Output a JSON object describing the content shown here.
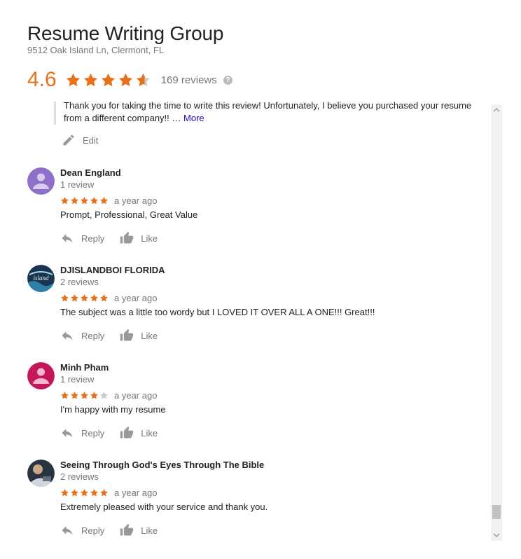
{
  "business": {
    "title": "Resume Writing Group",
    "address": "9512 Oak Island Ln, Clermont, FL",
    "rating": "4.6",
    "rating_value": 4.6,
    "review_count": "169 reviews",
    "help_glyph": "?"
  },
  "owner_reply": {
    "text": "Thank you for taking the time to write this review! Unfortunately, I believe you purchased your resume from a different company!!",
    "ellipsis": " … ",
    "more_label": "More",
    "edit_label": "Edit"
  },
  "reviews": [
    {
      "name": "Dean England",
      "sub": "1 review",
      "stars": 5,
      "time": "a year ago",
      "text": "Prompt, Professional, Great Value",
      "reply_label": "Reply",
      "like_label": "Like",
      "avatar_color": "#8e6fc9"
    },
    {
      "name": "DJISLANDBOI FLORIDA",
      "sub": "2 reviews",
      "stars": 5,
      "time": "a year ago",
      "text": "The subject was a little too wordy but I LOVED IT OVER ALL A ONE!!! Great!!!",
      "reply_label": "Reply",
      "like_label": "Like",
      "avatar_color": "#1b3550"
    },
    {
      "name": "Minh Pham",
      "sub": "1 review",
      "stars": 4,
      "time": "a year ago",
      "text": "I'm happy with my resume",
      "reply_label": "Reply",
      "like_label": "Like",
      "avatar_color": "#c2185b"
    },
    {
      "name": "Seeing Through God's Eyes Through The Bible",
      "sub": "2 reviews",
      "stars": 5,
      "time": "a year ago",
      "text": "Extremely pleased with your service and thank you.",
      "reply_label": "Reply",
      "like_label": "Like",
      "avatar_color": "#2a3440"
    }
  ],
  "colors": {
    "star": "#e7711b",
    "star_empty": "#cccccc",
    "muted": "#777777",
    "link": "#1a0dab"
  }
}
